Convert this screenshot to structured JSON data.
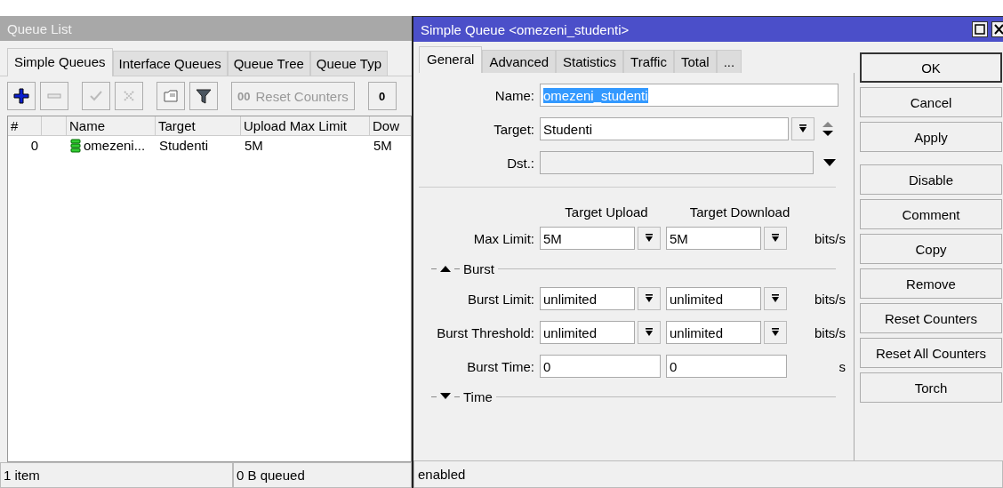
{
  "queue_list": {
    "title": "Queue List",
    "tabs": [
      {
        "label": "Simple Queues",
        "selected": true
      },
      {
        "label": "Interface Queues",
        "selected": false
      },
      {
        "label": "Queue Tree",
        "selected": false
      },
      {
        "label": "Queue Typ",
        "selected": false
      }
    ],
    "toolbar": [
      {
        "kind": "add",
        "disabled": false
      },
      {
        "kind": "remove",
        "disabled": true
      },
      {
        "kind": "enable",
        "disabled": true
      },
      {
        "kind": "disable",
        "disabled": true
      },
      {
        "kind": "comment",
        "disabled": false
      },
      {
        "kind": "filter",
        "disabled": false
      },
      {
        "kind": "text",
        "icon": "00",
        "label": "Reset Counters",
        "disabled": true
      },
      {
        "kind": "text",
        "icon": "0",
        "disabled": false
      }
    ],
    "table": {
      "columns": [
        "#",
        "",
        "Name",
        "Target",
        "Upload Max Limit",
        "Dow"
      ],
      "rows": [
        {
          "number": "0",
          "name": "omezeni...",
          "target": "Studenti",
          "upload_max_limit": "5M",
          "column_6": "5M",
          "selected": false
        }
      ]
    },
    "status_bar": [
      "1 item",
      "0 B queued"
    ]
  },
  "dialog": {
    "title": "Simple Queue <omezeni_studenti>",
    "tabs": [
      {
        "label": "General",
        "selected": true
      },
      {
        "label": "Advanced",
        "selected": false
      },
      {
        "label": "Statistics",
        "selected": false
      },
      {
        "label": "Traffic",
        "selected": false
      },
      {
        "label": "Total",
        "selected": false
      },
      {
        "label": "...",
        "selected": false
      }
    ],
    "name": {
      "label": "Name:",
      "value": "omezeni_studenti",
      "value_selected": true
    },
    "target": {
      "label": "Target:",
      "value": "Studenti"
    },
    "dst": {
      "label": "Dst.:",
      "disabled": true
    },
    "column_headers": [
      "Target Upload",
      "Target Download"
    ],
    "rows": [
      {
        "kind": "pair",
        "label": "Max Limit:",
        "upload": "5M",
        "download": "5M",
        "unit": "bits/s",
        "dropdown": true
      },
      {
        "kind": "section",
        "label": "Burst",
        "expanded": true
      },
      {
        "kind": "pair",
        "label": "Burst Limit:",
        "upload": "unlimited",
        "download": "unlimited",
        "unit": "bits/s",
        "dropdown": true
      },
      {
        "kind": "pair",
        "label": "Burst Threshold:",
        "upload": "unlimited",
        "download": "unlimited",
        "unit": "bits/s",
        "dropdown": true
      },
      {
        "kind": "pair",
        "label": "Burst Time:",
        "upload": "0",
        "download": "0",
        "unit": "s",
        "dropdown": false
      },
      {
        "kind": "section",
        "label": "Time",
        "expanded": false
      }
    ],
    "buttons": [
      {
        "label": "OK",
        "default": true
      },
      {
        "label": "Cancel",
        "default": false
      },
      {
        "label": "Apply",
        "default": false
      },
      {
        "label": "Disable",
        "default": false
      },
      {
        "label": "Comment",
        "default": false
      },
      {
        "label": "Copy",
        "default": false
      },
      {
        "label": "Remove",
        "default": false
      },
      {
        "label": "Reset Counters",
        "default": false
      },
      {
        "label": "Reset All Counters",
        "default": false
      },
      {
        "label": "Torch",
        "default": false
      }
    ],
    "status": "enabled"
  }
}
